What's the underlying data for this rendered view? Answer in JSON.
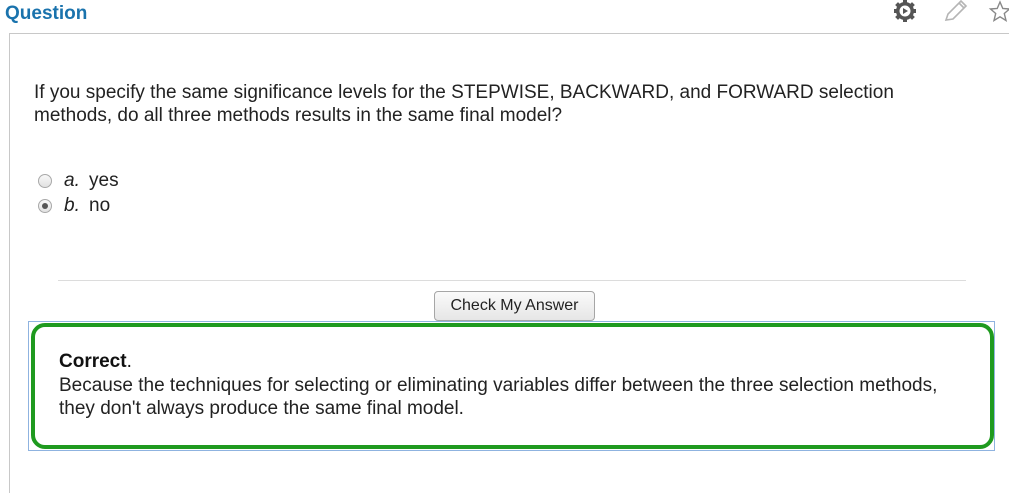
{
  "header": {
    "title": "Question",
    "icons": [
      "gear-play-icon",
      "pencil-icon",
      "star-icon"
    ]
  },
  "question": {
    "text": "If you specify the same significance levels for the STEPWISE, BACKWARD, and FORWARD selection methods, do all three methods results in the same final model?",
    "options": [
      {
        "letter": "a.",
        "label": "yes",
        "selected": false
      },
      {
        "letter": "b.",
        "label": "no",
        "selected": true
      }
    ]
  },
  "actions": {
    "check_label": "Check My Answer"
  },
  "feedback": {
    "status": "Correct",
    "status_suffix": ".",
    "text": "Because the techniques for selecting or eliminating variables differ between the three selection methods, they don't always produce the same final model.",
    "border_color": "#1f9a1f"
  },
  "colors": {
    "title": "#1a73ad"
  }
}
